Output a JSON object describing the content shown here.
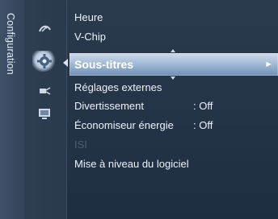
{
  "sidebar": {
    "title": "Configuration"
  },
  "icons": [
    "satellite-dish-icon",
    "gear-icon",
    "plug-icon",
    "monitor-icon"
  ],
  "menu": {
    "items": [
      {
        "label": "Heure",
        "value": ""
      },
      {
        "label": "V-Chip",
        "value": ""
      },
      {
        "label": "Sous-titres",
        "value": "",
        "selected": true,
        "arrow": "►"
      },
      {
        "label": "Réglages externes",
        "value": ""
      },
      {
        "label": "Divertissement",
        "value": ": Off"
      },
      {
        "label": "Économiseur énergie",
        "value": ": Off"
      },
      {
        "label": "ISI",
        "value": "",
        "disabled": true
      },
      {
        "label": "Mise à niveau du logiciel",
        "value": ""
      }
    ]
  }
}
